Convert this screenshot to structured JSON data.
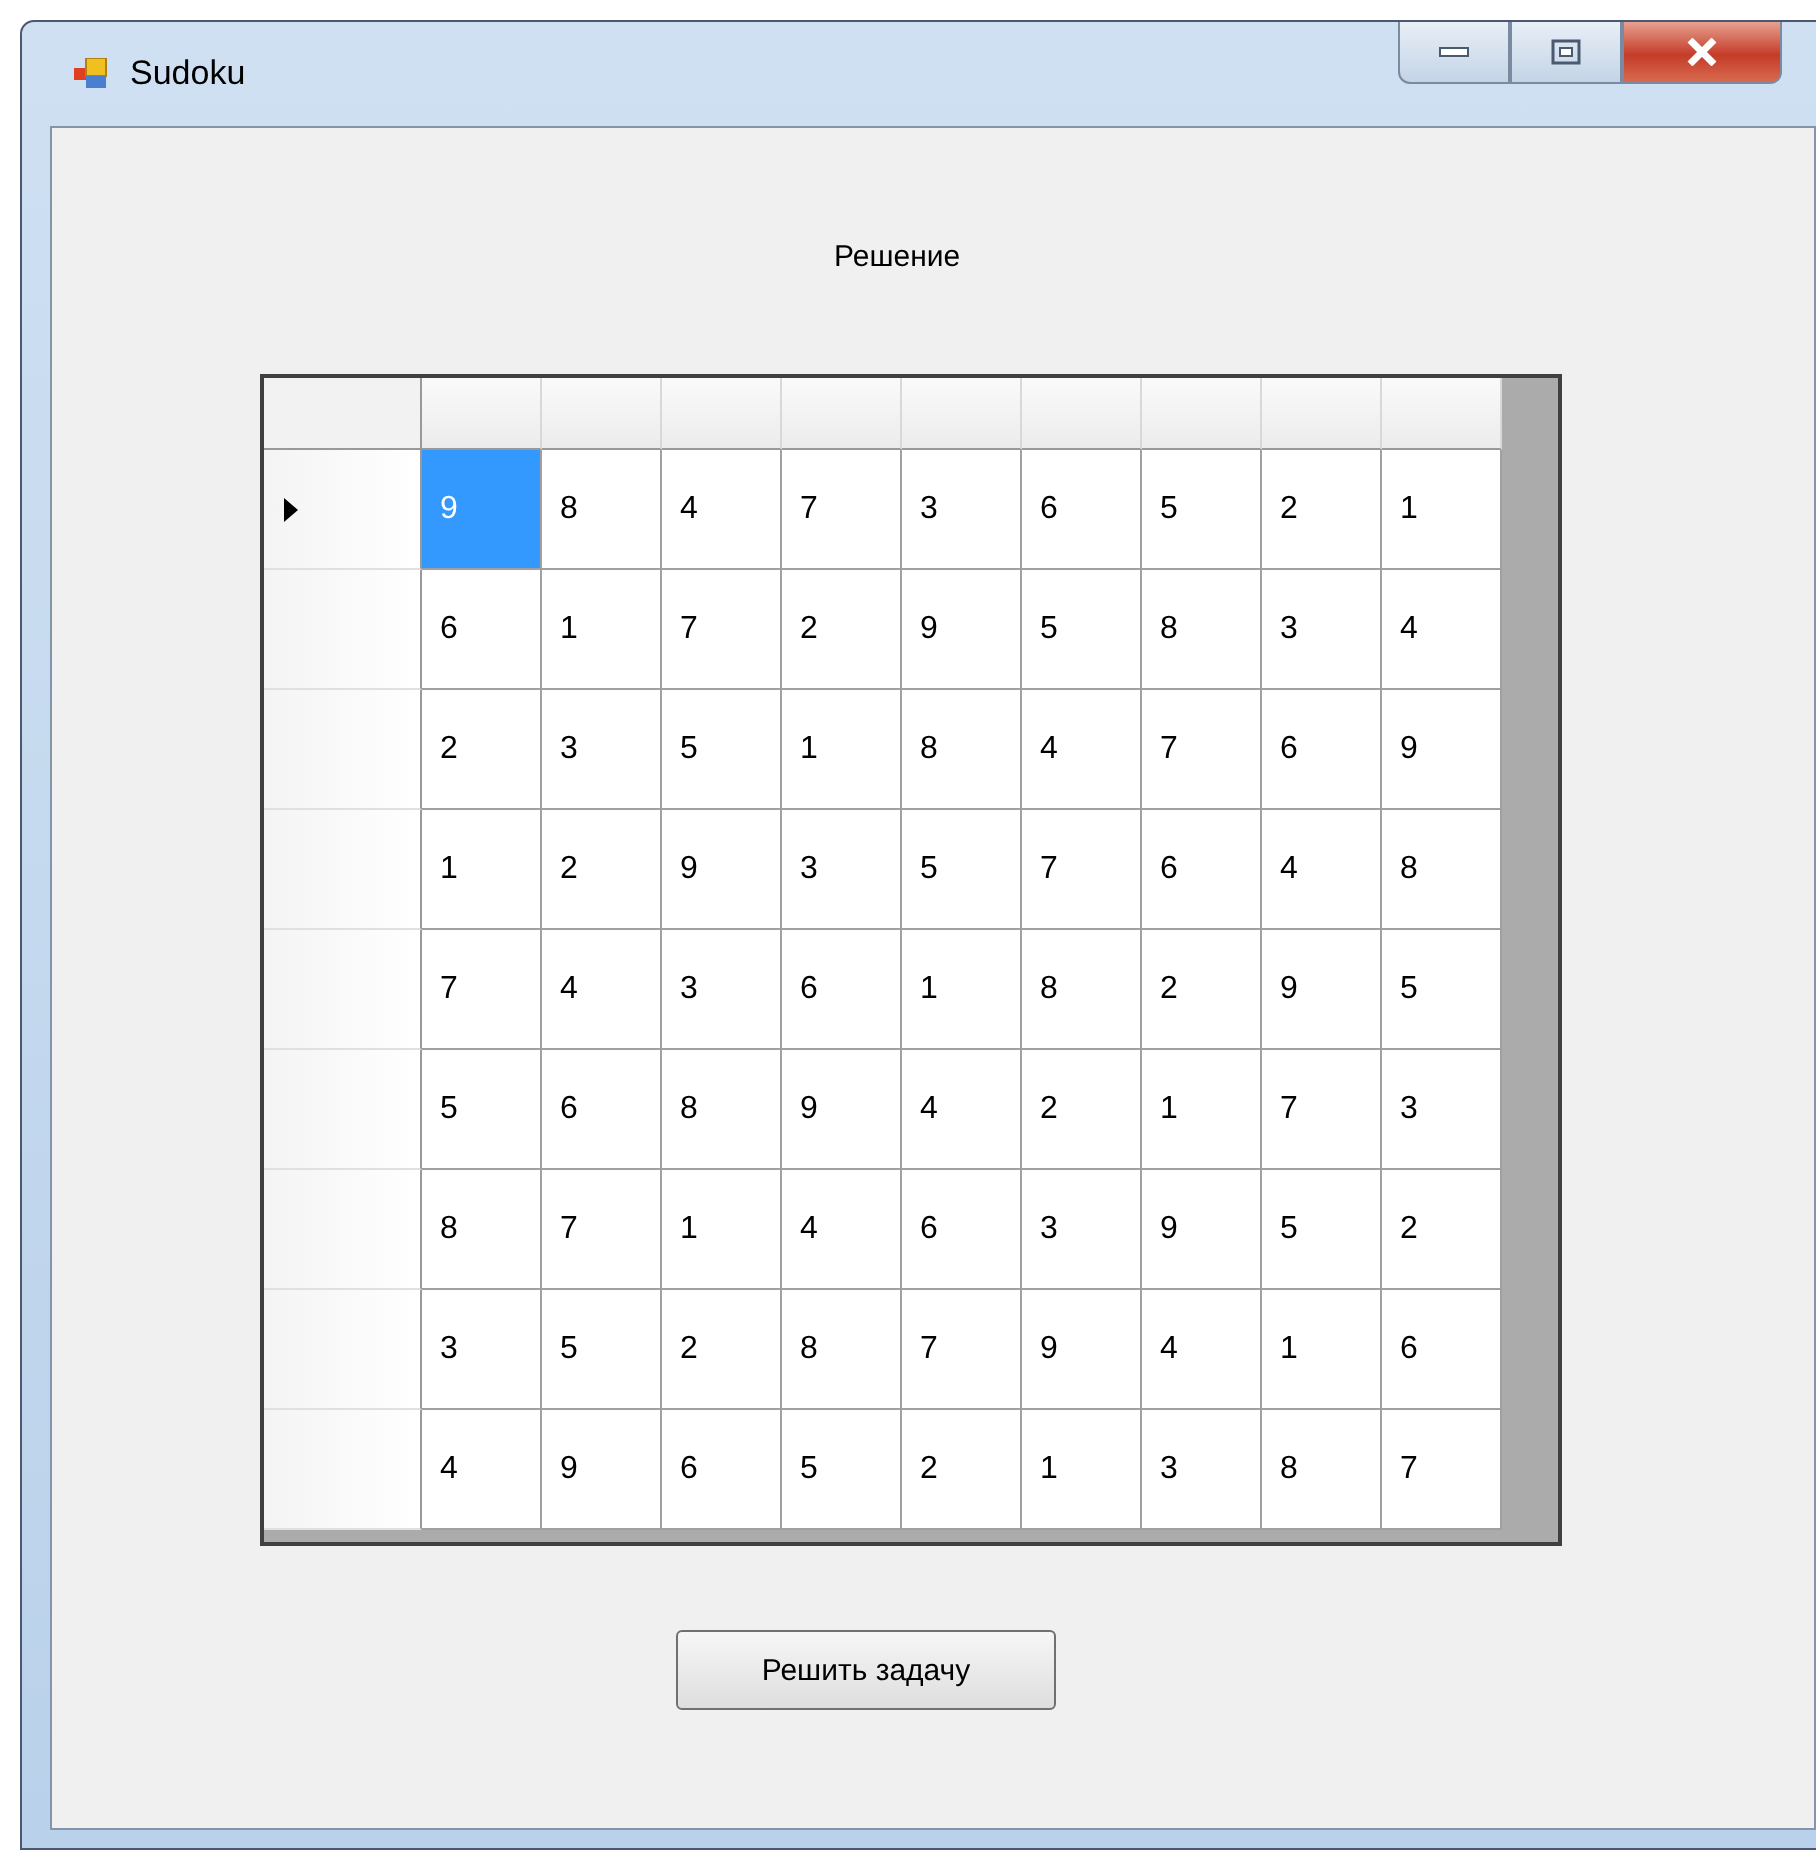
{
  "window": {
    "title": "Sudoku"
  },
  "heading": "Решение",
  "grid": {
    "rows": [
      {
        "current": true,
        "cells": [
          {
            "value": "9",
            "selected": true
          },
          {
            "value": "8",
            "selected": false
          },
          {
            "value": "4",
            "selected": false
          },
          {
            "value": "7",
            "selected": false
          },
          {
            "value": "3",
            "selected": false
          },
          {
            "value": "6",
            "selected": false
          },
          {
            "value": "5",
            "selected": false
          },
          {
            "value": "2",
            "selected": false
          },
          {
            "value": "1",
            "selected": false
          }
        ]
      },
      {
        "current": false,
        "cells": [
          {
            "value": "6",
            "selected": false
          },
          {
            "value": "1",
            "selected": false
          },
          {
            "value": "7",
            "selected": false
          },
          {
            "value": "2",
            "selected": false
          },
          {
            "value": "9",
            "selected": false
          },
          {
            "value": "5",
            "selected": false
          },
          {
            "value": "8",
            "selected": false
          },
          {
            "value": "3",
            "selected": false
          },
          {
            "value": "4",
            "selected": false
          }
        ]
      },
      {
        "current": false,
        "cells": [
          {
            "value": "2",
            "selected": false
          },
          {
            "value": "3",
            "selected": false
          },
          {
            "value": "5",
            "selected": false
          },
          {
            "value": "1",
            "selected": false
          },
          {
            "value": "8",
            "selected": false
          },
          {
            "value": "4",
            "selected": false
          },
          {
            "value": "7",
            "selected": false
          },
          {
            "value": "6",
            "selected": false
          },
          {
            "value": "9",
            "selected": false
          }
        ]
      },
      {
        "current": false,
        "cells": [
          {
            "value": "1",
            "selected": false
          },
          {
            "value": "2",
            "selected": false
          },
          {
            "value": "9",
            "selected": false
          },
          {
            "value": "3",
            "selected": false
          },
          {
            "value": "5",
            "selected": false
          },
          {
            "value": "7",
            "selected": false
          },
          {
            "value": "6",
            "selected": false
          },
          {
            "value": "4",
            "selected": false
          },
          {
            "value": "8",
            "selected": false
          }
        ]
      },
      {
        "current": false,
        "cells": [
          {
            "value": "7",
            "selected": false
          },
          {
            "value": "4",
            "selected": false
          },
          {
            "value": "3",
            "selected": false
          },
          {
            "value": "6",
            "selected": false
          },
          {
            "value": "1",
            "selected": false
          },
          {
            "value": "8",
            "selected": false
          },
          {
            "value": "2",
            "selected": false
          },
          {
            "value": "9",
            "selected": false
          },
          {
            "value": "5",
            "selected": false
          }
        ]
      },
      {
        "current": false,
        "cells": [
          {
            "value": "5",
            "selected": false
          },
          {
            "value": "6",
            "selected": false
          },
          {
            "value": "8",
            "selected": false
          },
          {
            "value": "9",
            "selected": false
          },
          {
            "value": "4",
            "selected": false
          },
          {
            "value": "2",
            "selected": false
          },
          {
            "value": "1",
            "selected": false
          },
          {
            "value": "7",
            "selected": false
          },
          {
            "value": "3",
            "selected": false
          }
        ]
      },
      {
        "current": false,
        "cells": [
          {
            "value": "8",
            "selected": false
          },
          {
            "value": "7",
            "selected": false
          },
          {
            "value": "1",
            "selected": false
          },
          {
            "value": "4",
            "selected": false
          },
          {
            "value": "6",
            "selected": false
          },
          {
            "value": "3",
            "selected": false
          },
          {
            "value": "9",
            "selected": false
          },
          {
            "value": "5",
            "selected": false
          },
          {
            "value": "2",
            "selected": false
          }
        ]
      },
      {
        "current": false,
        "cells": [
          {
            "value": "3",
            "selected": false
          },
          {
            "value": "5",
            "selected": false
          },
          {
            "value": "2",
            "selected": false
          },
          {
            "value": "8",
            "selected": false
          },
          {
            "value": "7",
            "selected": false
          },
          {
            "value": "9",
            "selected": false
          },
          {
            "value": "4",
            "selected": false
          },
          {
            "value": "1",
            "selected": false
          },
          {
            "value": "6",
            "selected": false
          }
        ]
      },
      {
        "current": false,
        "cells": [
          {
            "value": "4",
            "selected": false
          },
          {
            "value": "9",
            "selected": false
          },
          {
            "value": "6",
            "selected": false
          },
          {
            "value": "5",
            "selected": false
          },
          {
            "value": "2",
            "selected": false
          },
          {
            "value": "1",
            "selected": false
          },
          {
            "value": "3",
            "selected": false
          },
          {
            "value": "8",
            "selected": false
          },
          {
            "value": "7",
            "selected": false
          }
        ]
      }
    ]
  },
  "buttons": [
    "Решить задачу"
  ]
}
